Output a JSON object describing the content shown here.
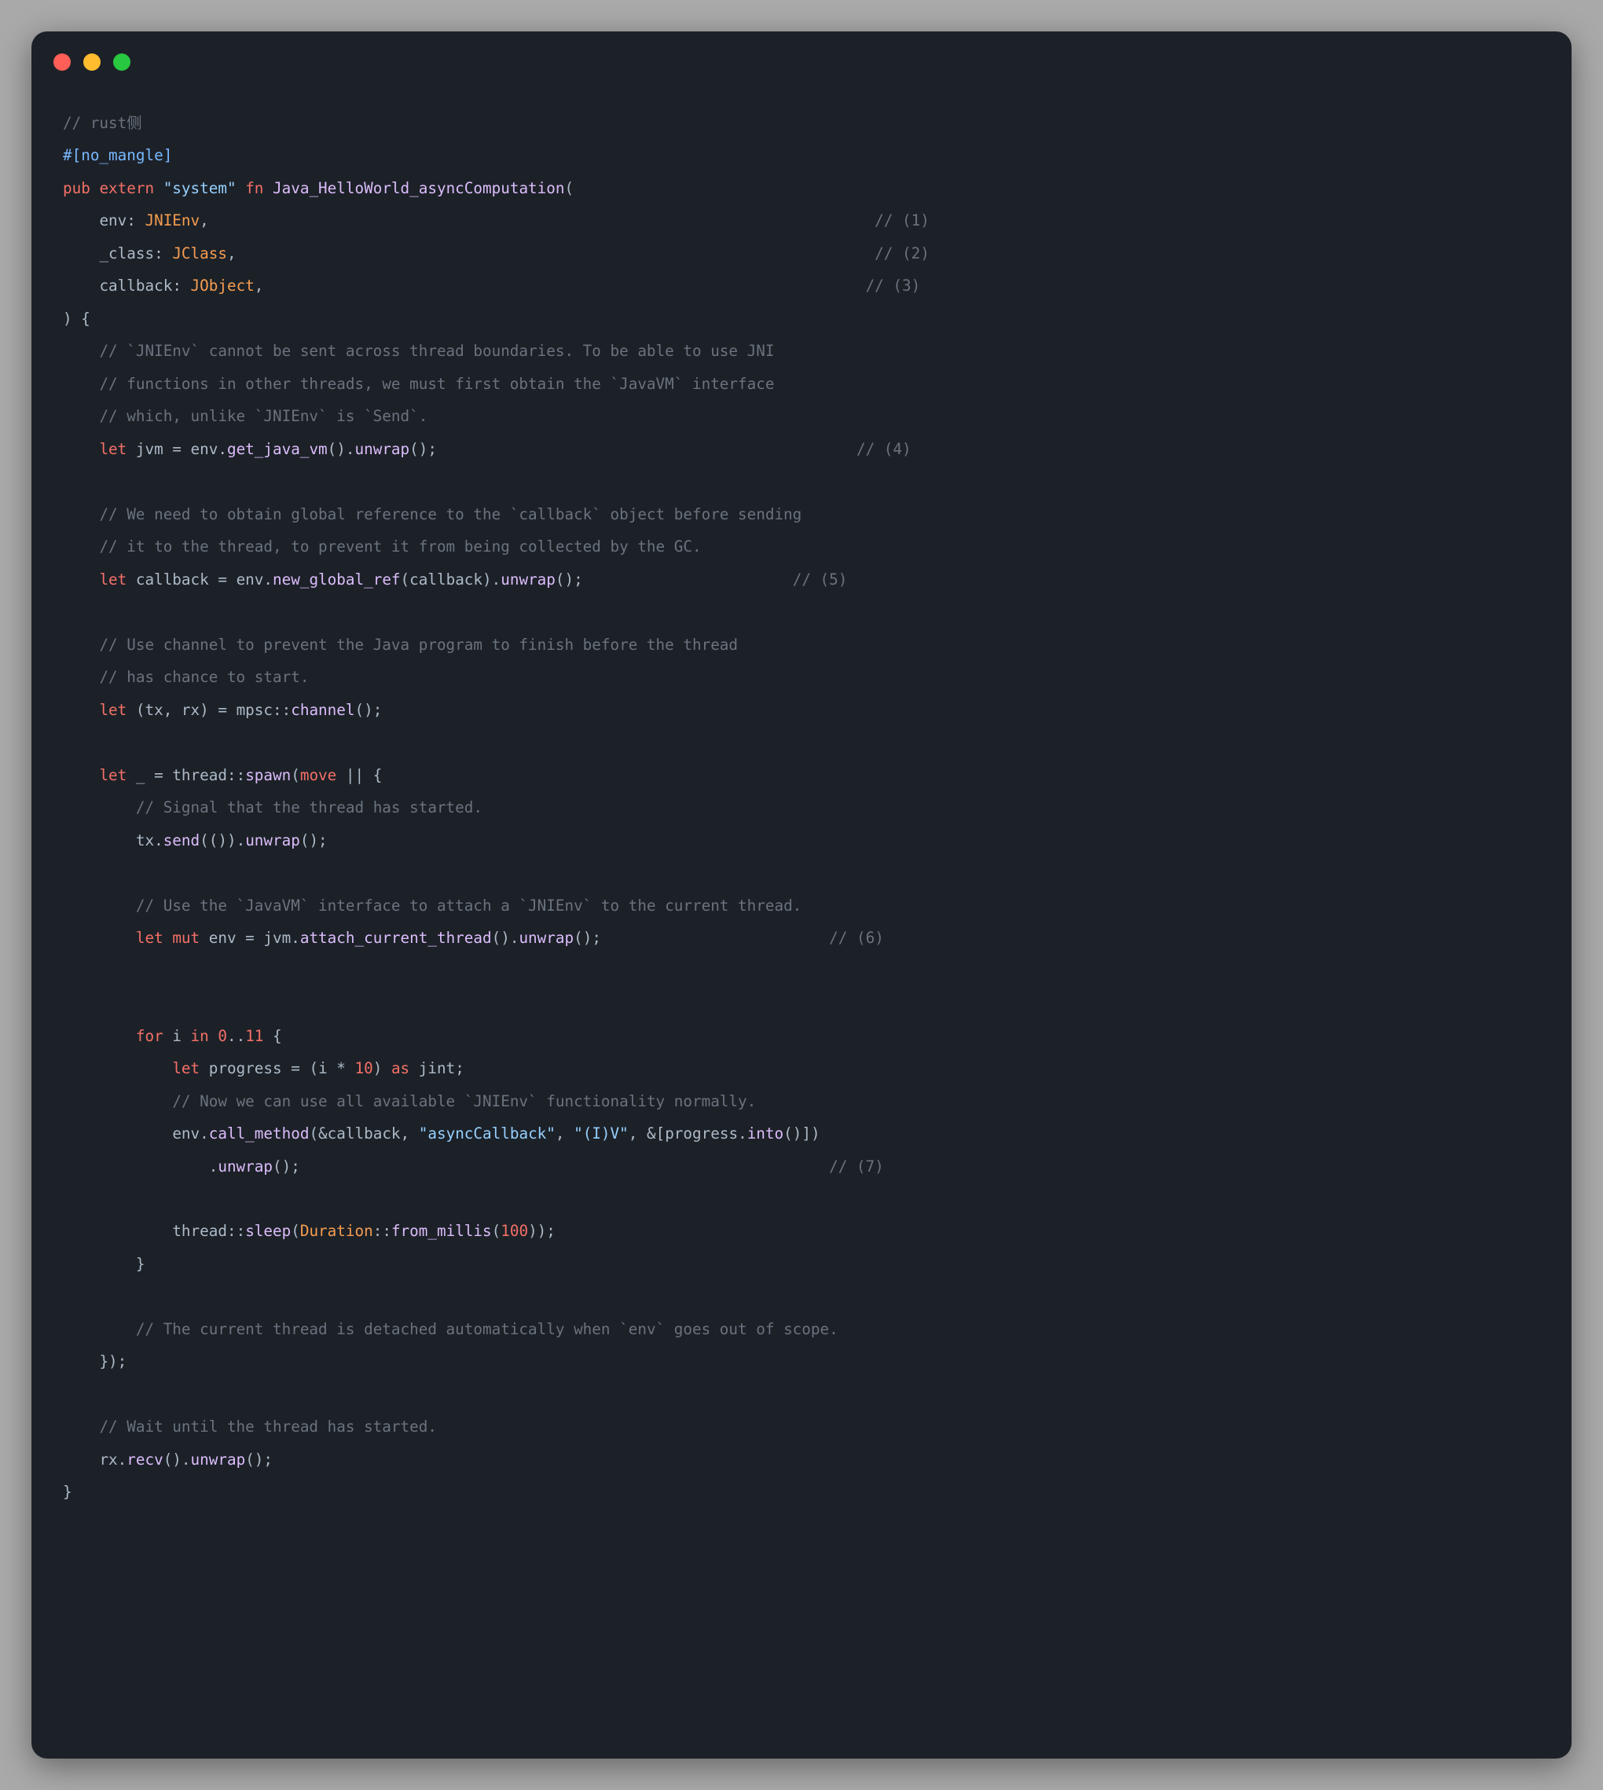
{
  "traffic": {
    "red": "#ff5f57",
    "yellow": "#febc2e",
    "green": "#28c840"
  },
  "code": {
    "l01_comment": "// rust侧",
    "l02_attr": "#[no_mangle]",
    "l03_pub": "pub",
    "l03_extern": "extern",
    "l03_system": "\"system\"",
    "l03_fn": "fn",
    "l03_func": "Java_HelloWorld_asyncComputation",
    "l03_open": "(",
    "l04_env": "env",
    "l04_colon": ": ",
    "l04_type": "JNIEnv",
    "l04_comma": ",",
    "l04_comment": "// (1)",
    "l05_class": "_class",
    "l05_type": "JClass",
    "l05_comment": "// (2)",
    "l06_callback": "callback",
    "l06_type": "JObject",
    "l06_comment": "// (3)",
    "l07_close": ") {",
    "l08_comment": "// `JNIEnv` cannot be sent across thread boundaries. To be able to use JNI",
    "l09_comment": "// functions in other threads, we must first obtain the `JavaVM` interface",
    "l10_comment": "// which, unlike `JNIEnv` is `Send`.",
    "l11_let": "let",
    "l11_jvm": "jvm",
    "l11_eq": " = ",
    "l11_env": "env",
    "l11_dot1": ".",
    "l11_get": "get_java_vm",
    "l11_pp": "().",
    "l11_unwrap": "unwrap",
    "l11_end": "();",
    "l11_comment": "// (4)",
    "l13_comment": "// We need to obtain global reference to the `callback` object before sending",
    "l14_comment": "// it to the thread, to prevent it from being collected by the GC.",
    "l15_let": "let",
    "l15_cb": "callback",
    "l15_eq": " = ",
    "l15_env": "env",
    "l15_dot": ".",
    "l15_newref": "new_global_ref",
    "l15_open": "(",
    "l15_arg": "callback",
    "l15_close": ").",
    "l15_unwrap": "unwrap",
    "l15_end": "();",
    "l15_comment": "// (5)",
    "l17_comment": "// Use channel to prevent the Java program to finish before the thread",
    "l18_comment": "// has chance to start.",
    "l19_let": "let",
    "l19_tuple": "(tx, rx)",
    "l19_eq": " = ",
    "l19_mpsc": "mpsc",
    "l19_dd": "::",
    "l19_channel": "channel",
    "l19_end": "();",
    "l21_let": "let",
    "l21_us": "_",
    "l21_eq": " = ",
    "l21_thread": "thread",
    "l21_dd": "::",
    "l21_spawn": "spawn",
    "l21_open": "(",
    "l21_move": "move",
    "l21_bars": " || {",
    "l22_comment": "// Signal that the thread has started.",
    "l23_tx": "tx",
    "l23_dot": ".",
    "l23_send": "send",
    "l23_args": "(()).",
    "l23_unwrap": "unwrap",
    "l23_end": "();",
    "l25_comment": "// Use the `JavaVM` interface to attach a `JNIEnv` to the current thread.",
    "l26_let": "let",
    "l26_mut": "mut",
    "l26_env": "env",
    "l26_eq": " = ",
    "l26_jvm": "jvm",
    "l26_dot": ".",
    "l26_attach": "attach_current_thread",
    "l26_pp": "().",
    "l26_unwrap": "unwrap",
    "l26_end": "();",
    "l26_comment": "// (6)",
    "l29_for": "for",
    "l29_i": "i",
    "l29_in": "in",
    "l29_zero": "0",
    "l29_dd": "..",
    "l29_eleven": "11",
    "l29_open": " {",
    "l30_let": "let",
    "l30_prog": "progress",
    "l30_eq": " = (",
    "l30_i": "i",
    "l30_star": " * ",
    "l30_ten": "10",
    "l30_close": ") ",
    "l30_as": "as",
    "l30_jint": " jint;",
    "l31_comment": "// Now we can use all available `JNIEnv` functionality normally.",
    "l32_env": "env",
    "l32_dot": ".",
    "l32_call": "call_method",
    "l32_open": "(&",
    "l32_cb": "callback",
    "l32_c1": ", ",
    "l32_s1": "\"asyncCallback\"",
    "l32_c2": ", ",
    "l32_s2": "\"(I)V\"",
    "l32_c3": ", &[",
    "l32_prog": "progress",
    "l32_dot2": ".",
    "l32_into": "into",
    "l32_rest": "()])",
    "l33_dot": ".",
    "l33_unwrap": "unwrap",
    "l33_end": "();",
    "l33_comment": "// (7)",
    "l35_thread": "thread",
    "l35_dd": "::",
    "l35_sleep": "sleep",
    "l35_open": "(",
    "l35_dur": "Duration",
    "l35_dd2": "::",
    "l35_from": "from_millis",
    "l35_open2": "(",
    "l35_hundred": "100",
    "l35_end": "));",
    "l36_close": "}",
    "l38_comment": "// The current thread is detached automatically when `env` goes out of scope.",
    "l39_close": "});",
    "l41_comment": "// Wait until the thread has started.",
    "l42_rx": "rx",
    "l42_dot": ".",
    "l42_recv": "recv",
    "l42_pp": "().",
    "l42_unwrap": "unwrap",
    "l42_end": "();",
    "l43_close": "}",
    "pad_c1": "                                                                         ",
    "pad_c2": "                                                                      ",
    "pad_c3": "                                                                  ",
    "pad_c4": "                                              ",
    "pad_c5": "                       ",
    "pad_c6": "                         ",
    "pad_c7": "                                                          "
  }
}
